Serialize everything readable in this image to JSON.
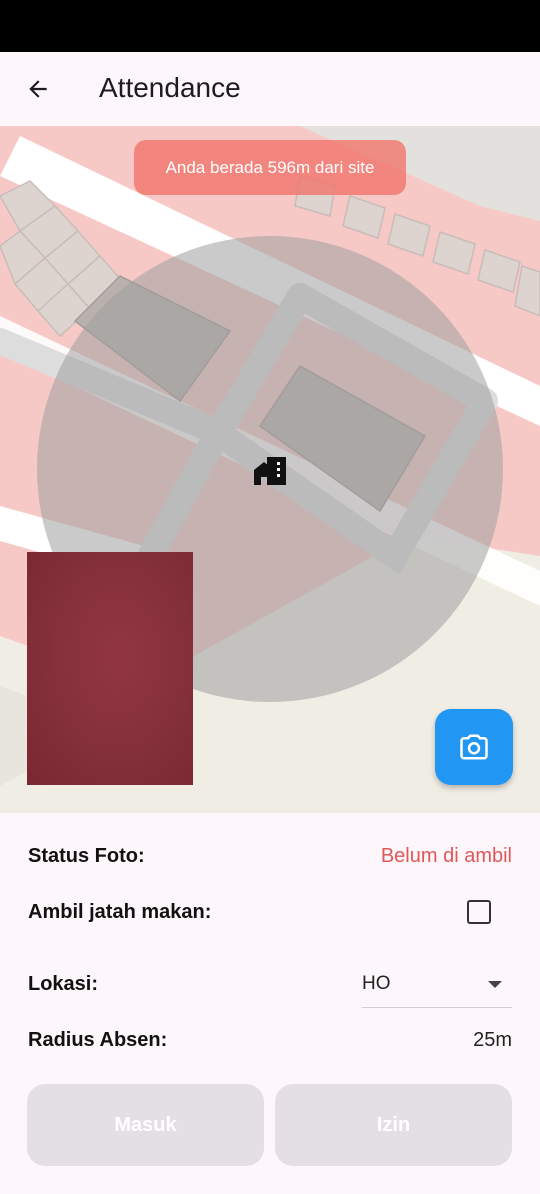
{
  "app_bar": {
    "title": "Attendance",
    "back_icon": "arrow-back-icon"
  },
  "map": {
    "distance_toast": "Anda berada 596m dari site",
    "site_marker_icon": "home-work-icon",
    "camera_button_icon": "camera-icon"
  },
  "form": {
    "status_foto_label": "Status Foto:",
    "status_foto_value": "Belum di ambil",
    "ambil_jatah_makan_label": "Ambil jatah makan:",
    "ambil_jatah_makan_checked": false,
    "lokasi_label": "Lokasi:",
    "lokasi_value": "HO",
    "radius_absen_label": "Radius Absen:",
    "radius_absen_value": "25m"
  },
  "buttons": {
    "masuk": "Masuk",
    "izin": "Izin"
  },
  "colors": {
    "background": "#fdf7fc",
    "toast": "#f0786e",
    "status_pending": "#e05757",
    "fab": "#2196f3",
    "button_disabled": "#e3dfe5"
  }
}
